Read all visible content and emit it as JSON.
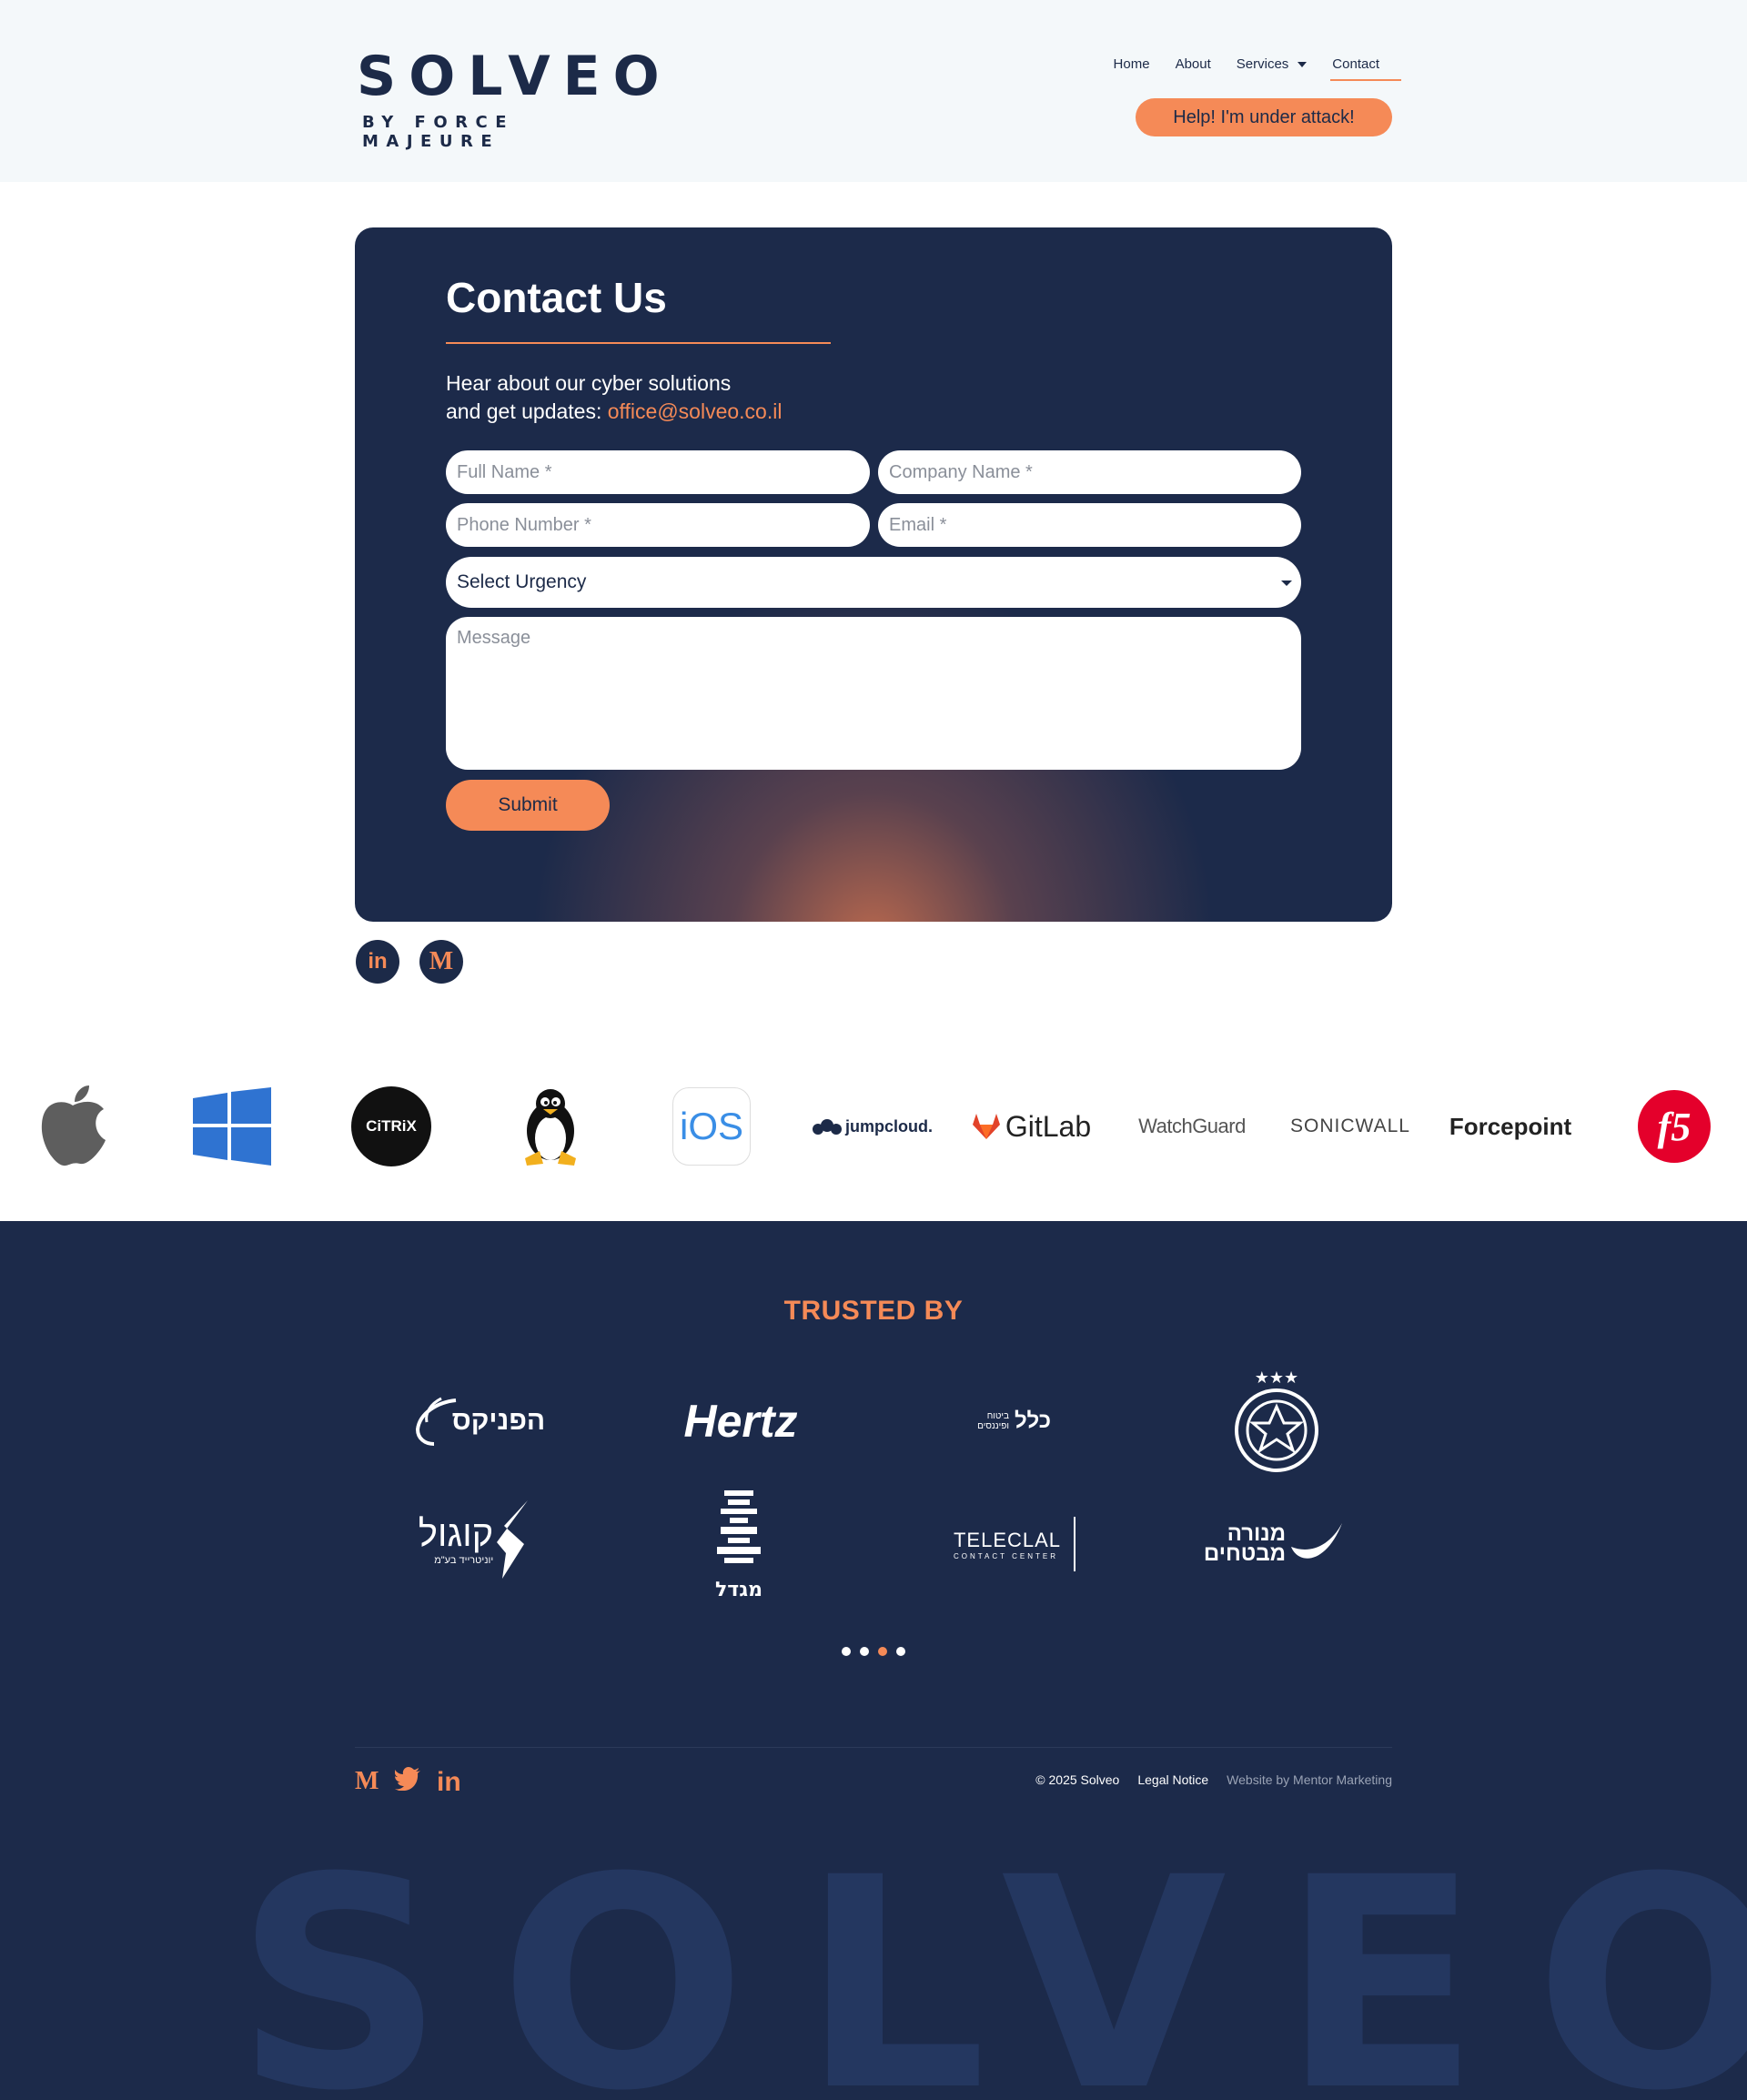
{
  "header": {
    "logo_main": "SOLVEO",
    "logo_sub": "BY FORCE MAJEURE",
    "nav": [
      "Home",
      "About",
      "Services",
      "Contact"
    ],
    "attack_button": "Help! I'm under attack!"
  },
  "contact": {
    "title": "Contact Us",
    "text_line1": "Hear about our cyber solutions",
    "text_line2": "and get updates: ",
    "email": "office@solveo.co.il",
    "placeholders": {
      "full_name": "Full Name *",
      "company_name": "Company Name *",
      "phone": "Phone Number *",
      "email": "Email *",
      "message": "Message"
    },
    "urgency_select": "Select Urgency",
    "submit": "Submit"
  },
  "social_circles": [
    "in",
    "M"
  ],
  "tech_logos": {
    "citrix": "CiTRiX",
    "ios": "iOS",
    "jumpcloud": "jumpcloud.",
    "gitlab": "GitLab",
    "watchguard": "WatchGuard",
    "sonicwall": "SONICWALL",
    "forcepoint": "Forcepoint",
    "f5": "f5"
  },
  "footer": {
    "trusted_by": "TRUSTED BY",
    "clients": {
      "phoenix": "הפניקס",
      "hertz": "Hertz",
      "clal": "כלל",
      "clal_sub": "ביטוח ופיננסים",
      "kogol": "קוגול",
      "kogol_sub": "יוניטרייד בע\"מ",
      "migdal": "מגדל",
      "teleclal": "TELECLAL",
      "teleclal_sub": "CONTACT CENTER",
      "menora": "מנורה",
      "menora_sub": "מבטחים"
    },
    "copyright": "© 2025 Solveo",
    "legal": "Legal Notice",
    "credit": "Website by Mentor Marketing",
    "watermark": "SOLVEO"
  },
  "colors": {
    "accent": "#f58a57",
    "navy": "#1c2a4a",
    "header_bg": "#f4f8fa"
  }
}
